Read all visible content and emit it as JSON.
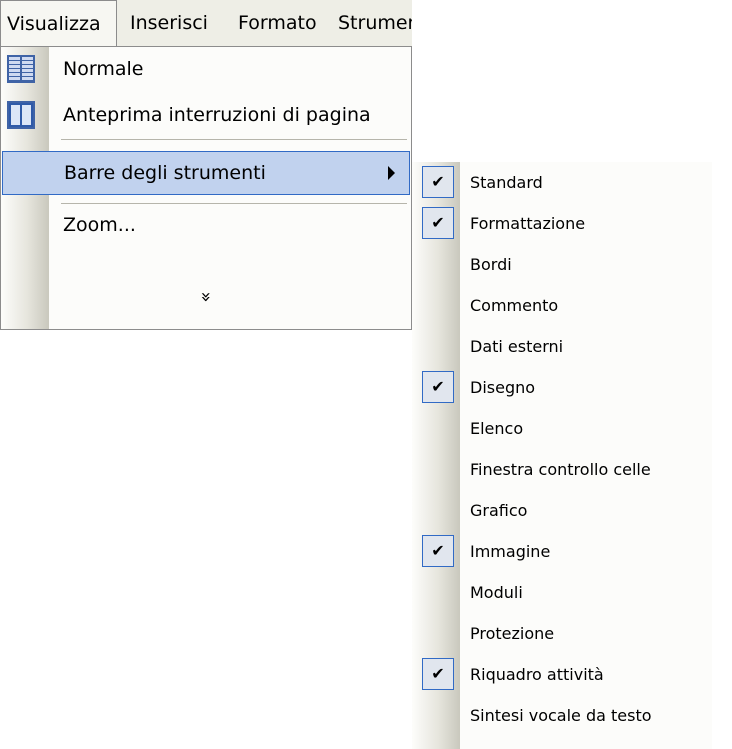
{
  "menubar": {
    "items": [
      {
        "label": "Visualizza",
        "active": true
      },
      {
        "label": "Inserisci",
        "active": false
      },
      {
        "label": "Formato",
        "active": false
      },
      {
        "label": "Strumen",
        "active": false
      }
    ]
  },
  "view_menu": {
    "items": [
      {
        "label": "Normale",
        "icon": "normal-view-icon"
      },
      {
        "label": "Anteprima interruzioni di pagina",
        "icon": "page-break-preview-icon"
      },
      {
        "label": "Barre degli strumenti",
        "has_submenu": true,
        "highlighted": true
      },
      {
        "label": "Zoom..."
      }
    ],
    "expand_glyph": "»"
  },
  "toolbars_submenu": {
    "check_glyph": "✔",
    "items": [
      {
        "label": "Standard",
        "checked": true
      },
      {
        "label": "Formattazione",
        "checked": true
      },
      {
        "label": "Bordi",
        "checked": false
      },
      {
        "label": "Commento",
        "checked": false
      },
      {
        "label": "Dati esterni",
        "checked": false
      },
      {
        "label": "Disegno",
        "checked": true
      },
      {
        "label": "Elenco",
        "checked": false
      },
      {
        "label": "Finestra controllo celle",
        "checked": false
      },
      {
        "label": "Grafico",
        "checked": false
      },
      {
        "label": "Immagine",
        "checked": true
      },
      {
        "label": "Moduli",
        "checked": false
      },
      {
        "label": "Protezione",
        "checked": false
      },
      {
        "label": "Riquadro attività",
        "checked": true
      },
      {
        "label": "Sintesi vocale da testo",
        "checked": false
      }
    ]
  },
  "colors": {
    "highlight_fill": "#c1d2ee",
    "highlight_border": "#316ac5",
    "gutter": "#e6e5dd"
  }
}
